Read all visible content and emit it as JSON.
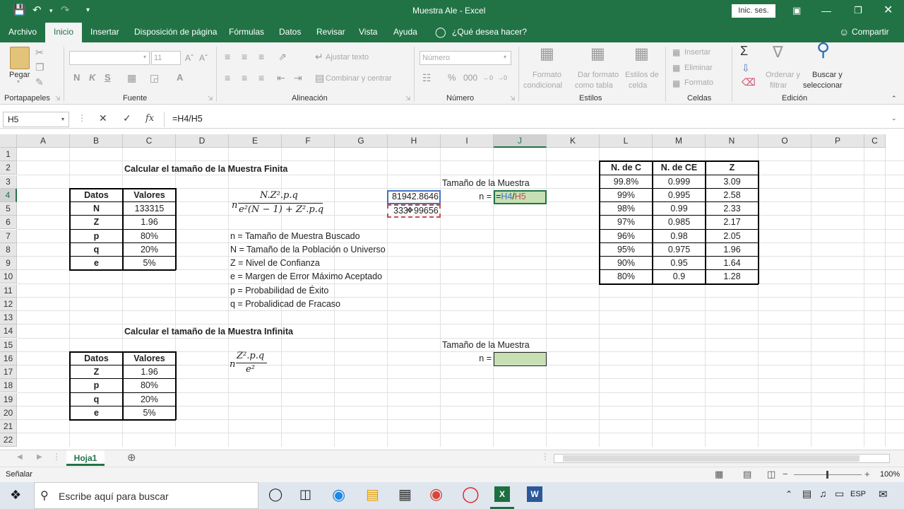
{
  "window": {
    "title": "Muestra Ale - Excel",
    "signin_label": "Inic. ses.",
    "share_label": "Compartir"
  },
  "tabs": [
    "Archivo",
    "Inicio",
    "Insertar",
    "Disposición de página",
    "Fórmulas",
    "Datos",
    "Revisar",
    "Vista",
    "Ayuda",
    "¿Qué desea hacer?"
  ],
  "ribbon": {
    "paste": "Pegar",
    "portapapeles": "Portapapeles",
    "fuente": "Fuente",
    "font_size": "11",
    "ajustar_texto": "Ajustar texto",
    "combinar": "Combinar y centrar",
    "alineacion": "Alineación",
    "numero_format": "Número",
    "numero": "Número",
    "formato_condicional_1": "Formato",
    "formato_condicional_2": "condicional",
    "dar_formato_1": "Dar formato",
    "dar_formato_2": "como tabla",
    "estilos_celda_1": "Estilos de",
    "estilos_celda_2": "celda",
    "estilos": "Estilos",
    "insertar": "Insertar",
    "eliminar": "Eliminar",
    "formato": "Formato",
    "celdas": "Celdas",
    "ordenar_1": "Ordenar y",
    "ordenar_2": "filtrar",
    "buscar_1": "Buscar y",
    "buscar_2": "seleccionar",
    "edicion": "Edición",
    "bold": "N",
    "italic": "K",
    "underline": "S"
  },
  "formula_bar": {
    "name_box": "H5",
    "formula": "=H4/H5",
    "fx": "fx"
  },
  "columns": [
    "A",
    "B",
    "C",
    "D",
    "E",
    "F",
    "G",
    "H",
    "I",
    "J",
    "K",
    "L",
    "M",
    "N",
    "O",
    "P",
    "C"
  ],
  "rows": [
    "1",
    "2",
    "3",
    "4",
    "5",
    "6",
    "7",
    "8",
    "9",
    "10",
    "11",
    "12",
    "13",
    "14",
    "15",
    "16",
    "17",
    "18",
    "19",
    "20",
    "21",
    "22"
  ],
  "finite": {
    "title": "Calcular el tamaño de la Muestra Finita",
    "header": [
      "Datos",
      "Valores"
    ],
    "rows": [
      [
        "N",
        "133315"
      ],
      [
        "Z",
        "1.96"
      ],
      [
        "p",
        "80%"
      ],
      [
        "q",
        "20%"
      ],
      [
        "e",
        "5%"
      ]
    ],
    "formula_n": "n",
    "numerator": "N.Z².p.q",
    "denominator": "e²(N − 1) + Z².p.q",
    "legend": [
      "n = Tamaño de Muestra Buscado",
      "N = Tamaño de la Población o Universo",
      "Z = Nivel de Confianza",
      "e = Margen de Error Máximo Aceptado",
      "p = Probabilidad de Éxito",
      "q = Probalidicad de Fracaso"
    ],
    "h4": "81942.8646",
    "h5_a": "333",
    "h5_b": "99656",
    "sample_label": "Tamaño de la Muestra",
    "n_label": "n =",
    "j4_eq": "=",
    "j4_ref1": "H4",
    "j4_slash": "/",
    "j4_ref2": "H5"
  },
  "infinite": {
    "title": "Calcular el tamaño de la Muestra Infinita",
    "header": [
      "Datos",
      "Valores"
    ],
    "rows": [
      [
        "Z",
        "1.96"
      ],
      [
        "p",
        "80%"
      ],
      [
        "q",
        "20%"
      ],
      [
        "e",
        "5%"
      ]
    ],
    "formula_n": "n",
    "numerator": "Z².p.q",
    "denominator": "e²",
    "sample_label": "Tamaño de la Muestra",
    "n_label": "n ="
  },
  "zt": {
    "header": [
      "N. de C",
      "N. de CE",
      "Z"
    ],
    "rows": [
      [
        "99.8%",
        "0.999",
        "3.09"
      ],
      [
        "99%",
        "0.995",
        "2.58"
      ],
      [
        "98%",
        "0.99",
        "2.33"
      ],
      [
        "97%",
        "0.985",
        "2.17"
      ],
      [
        "96%",
        "0.98",
        "2.05"
      ],
      [
        "95%",
        "0.975",
        "1.96"
      ],
      [
        "90%",
        "0.95",
        "1.64"
      ],
      [
        "80%",
        "0.9",
        "1.28"
      ]
    ]
  },
  "sheet_tab": "Hoja1",
  "status": {
    "mode": "Señalar",
    "zoom": "100%"
  },
  "taskbar": {
    "search": "Escribe aquí para buscar",
    "lang": "ESP"
  },
  "colors": {
    "excel_green": "#217346",
    "selection_fill": "#c6e0b4",
    "ref_blue": "#4472c4",
    "ref_red": "#c0504d"
  }
}
